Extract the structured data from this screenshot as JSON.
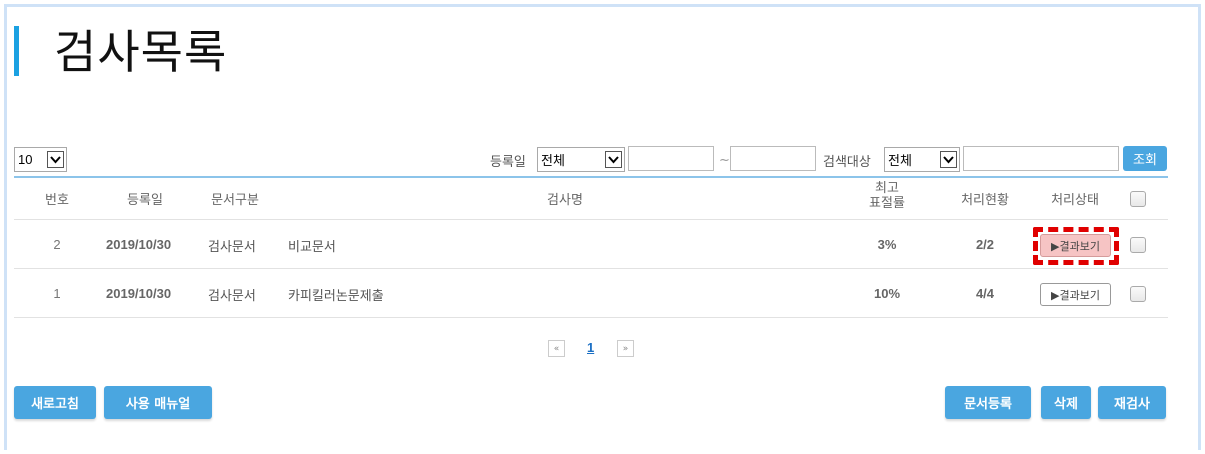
{
  "page": {
    "title": "검사목록"
  },
  "filters": {
    "page_size": "10",
    "date_label": "등록일",
    "date_range_value": "전체",
    "date_sep": "~",
    "target_label": "검색대상",
    "target_value": "전체",
    "search_button": "조회"
  },
  "table": {
    "headers": {
      "no": "번호",
      "date": "등록일",
      "type": "문서구분",
      "name": "검사명",
      "max_rate_1": "최고",
      "max_rate_2": "표절률",
      "progress": "처리현황",
      "status": "처리상태"
    },
    "rows": [
      {
        "no": "2",
        "date": "2019/10/30",
        "type": "검사문서",
        "name": "비교문서",
        "rate": "3%",
        "progress": "2/2",
        "result": "▶결과보기"
      },
      {
        "no": "1",
        "date": "2019/10/30",
        "type": "검사문서",
        "name": "카피킬러논문제출",
        "rate": "10%",
        "progress": "4/4",
        "result": "▶결과보기"
      }
    ]
  },
  "pagination": {
    "prev": "«",
    "current": "1",
    "next": "»"
  },
  "actions": {
    "refresh": "새로고침",
    "manual": "사용 매뉴얼",
    "register": "문서등록",
    "delete": "삭제",
    "recheck": "재검사"
  },
  "colors": {
    "accent": "#1ba1e2",
    "button": "#4aa6e0",
    "highlight": "#e00000"
  }
}
